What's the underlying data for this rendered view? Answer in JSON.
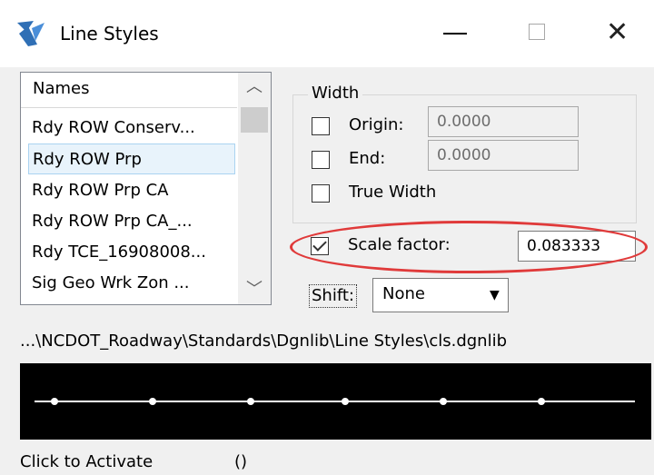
{
  "window": {
    "title": "Line Styles",
    "icon": "microstation-icon",
    "controls": [
      "minimize",
      "maximize",
      "close"
    ]
  },
  "names_list": {
    "header": "Names",
    "items": [
      "Rdy ROW Conserv...",
      "Rdy ROW Prp",
      "Rdy ROW Prp CA",
      "Rdy ROW Prp CA_...",
      "Rdy TCE_16908008...",
      "Sig Geo Wrk Zon ..."
    ],
    "selected": "Rdy ROW Prp",
    "scroll_up_icon": "chevron-up-icon",
    "scroll_down_icon": "chevron-down-icon"
  },
  "width_group": {
    "title": "Width",
    "origin": {
      "label": "Origin:",
      "value": "0.0000",
      "checked": false
    },
    "end": {
      "label": "End:",
      "value": "0.0000",
      "checked": false
    },
    "true_width": {
      "label": "True Width",
      "checked": false
    }
  },
  "scale_factor": {
    "label": "Scale factor:",
    "value": "0.083333",
    "checked": true,
    "highlight_color": "#e03a3a"
  },
  "shift": {
    "label": "Shift:",
    "value": "None"
  },
  "library_path": "...\\NCDOT_Roadway\\Standards\\Dgnlib\\Line Styles\\cls.dgnlib",
  "preview": {
    "background": "#000000",
    "line_color": "#ffffff"
  },
  "status": {
    "left": "Click to Activate",
    "right": "()"
  }
}
